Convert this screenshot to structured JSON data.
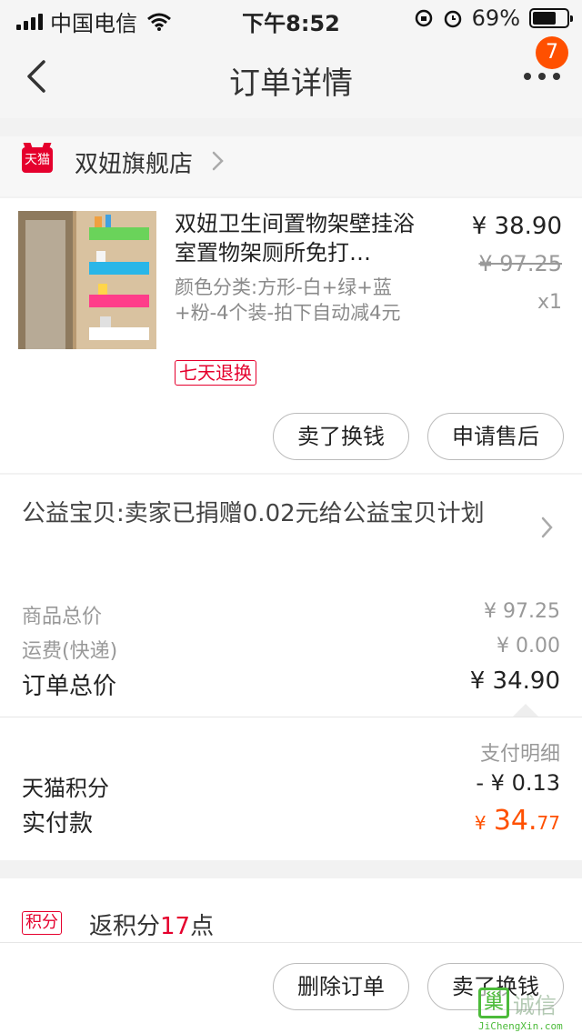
{
  "status_bar": {
    "carrier": "中国电信",
    "time": "下午8:52",
    "battery": "69%",
    "battery_level": 0.69
  },
  "nav": {
    "title": "订单详情",
    "badge_count": "7",
    "icons": {
      "back": "chevron-left-icon",
      "more": "more-dots-icon"
    }
  },
  "shop": {
    "logo_text": "天猫",
    "name": "双妞旗舰店"
  },
  "product": {
    "name": "双妞卫生间置物架壁挂浴室置物架厕所免打…",
    "sku": "颜色分类:方形-白+绿+蓝+粉-4个装-拍下自动减4元",
    "tag": "七天退换",
    "price": "¥ 38.90",
    "original_price": "¥ 97.25",
    "quantity": "x1",
    "btn_sell": "卖了换钱",
    "btn_aftersale": "申请售后"
  },
  "charity": {
    "text": "公益宝贝:卖家已捐赠0.02元给公益宝贝计划"
  },
  "totals": {
    "goods_label": "商品总价",
    "goods_value": "¥ 97.25",
    "shipping_label": "运费(快递)",
    "shipping_value": "¥ 0.00",
    "order_label": "订单总价",
    "order_value": "¥ 34.90"
  },
  "payment": {
    "detail_link": "支付明细",
    "points_label": "天猫积分",
    "points_value": "- ¥ 0.13",
    "paid_label": "实付款",
    "paid_symbol": "¥",
    "paid_int": "34.",
    "paid_dec": "77"
  },
  "points": {
    "tag": "积分",
    "prefix": "返积分",
    "num": "17",
    "suffix": "点"
  },
  "bottom": {
    "btn_delete": "删除订单",
    "btn_sell": "卖了换钱"
  },
  "watermark": {
    "logo_char": "巢",
    "text": "诚信",
    "url": "JiChengXin.com"
  },
  "colors": {
    "accent_orange": "#ff5000",
    "tmall_red": "#e5002d"
  }
}
